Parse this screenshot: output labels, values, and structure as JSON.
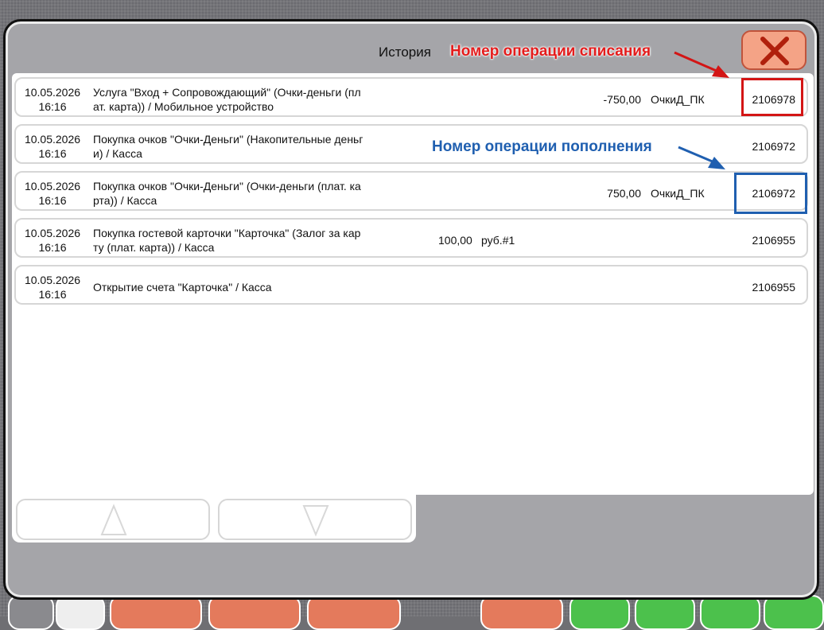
{
  "dialog": {
    "title": "История"
  },
  "annotations": {
    "debit": "Номер операции списания",
    "credit": "Номер операции пополнения",
    "debit_color": "#e41c1c",
    "credit_color": "#1f5fb0"
  },
  "rows": [
    {
      "date": "10.05.2026",
      "time": "16:16",
      "desc_line1": "Услуга \"Вход + Сопровождающий\" (Очки-деньги (пл",
      "desc_line2": "ат. карта)) / Мобильное устройство",
      "amount": "-750,00",
      "currency": "ОчкиД_ПК",
      "operation": "2106978"
    },
    {
      "date": "10.05.2026",
      "time": "16:16",
      "desc_line1": "Покупка очков \"Очки-Деньги\" (Накопительные деньг",
      "desc_line2": "и) / Касса",
      "amount": "",
      "currency": "",
      "operation": "2106972"
    },
    {
      "date": "10.05.2026",
      "time": "16:16",
      "desc_line1": "Покупка очков \"Очки-Деньги\" (Очки-деньги (плат. ка",
      "desc_line2": "рта)) / Касса",
      "amount": "750,00",
      "currency": "ОчкиД_ПК",
      "operation": "2106972"
    },
    {
      "date": "10.05.2026",
      "time": "16:16",
      "desc_line1": "Покупка гостевой карточки \"Карточка\" (Залог за кар",
      "desc_line2": "ту (плат. карта)) / Касса",
      "amount": "100,00",
      "currency": "руб.#1",
      "operation": "2106955"
    },
    {
      "date": "10.05.2026",
      "time": "16:16",
      "desc_line1": "Открытие счета \"Карточка\" / Касса",
      "desc_line2": "",
      "amount": "",
      "currency": "",
      "operation": "2106955"
    }
  ],
  "icons": {
    "close": "close-icon",
    "up": "triangle-up-icon",
    "down": "triangle-down-icon"
  }
}
